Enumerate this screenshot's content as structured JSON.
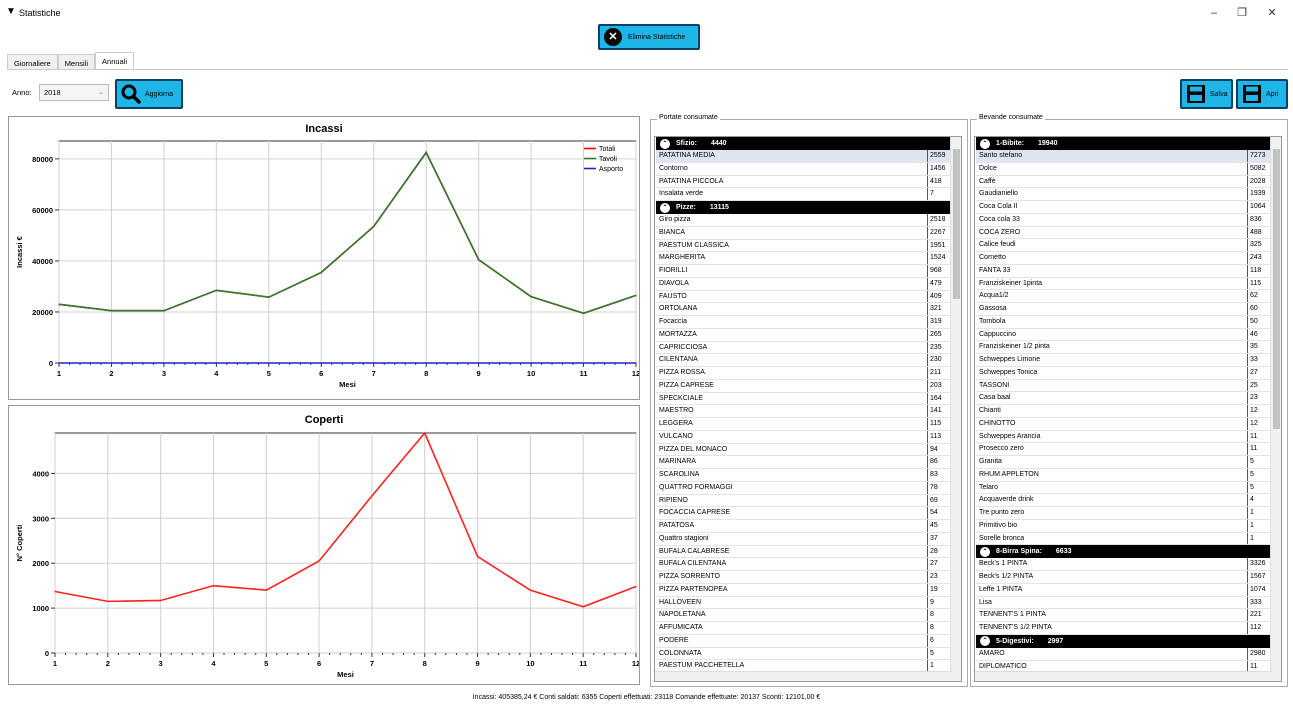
{
  "window": {
    "title": "Statistiche",
    "minimize": "–",
    "restore": "❐",
    "close": "✕"
  },
  "toolbar": {
    "elimina_label": "Elimina Statistiche"
  },
  "tabs": [
    {
      "label": "Giornaliere"
    },
    {
      "label": "Mensili"
    },
    {
      "label": "Annuali"
    }
  ],
  "controls": {
    "anno_label": "Anno:",
    "anno_value": "2018",
    "aggiorna_label": "Aggiorna",
    "salva_label": "Salva",
    "apri_label": "Apri"
  },
  "colors": {
    "button": "#1fb5e6",
    "totali": "#ff0000",
    "tavoli": "#2e7d32",
    "asporto": "#2222cc",
    "coperti": "#ff2020"
  },
  "chart_data": [
    {
      "type": "line",
      "title": "Incassi",
      "xlabel": "Mesi",
      "ylabel": "Incassi €",
      "x": [
        1,
        2,
        3,
        4,
        5,
        6,
        7,
        8,
        9,
        10,
        11,
        12
      ],
      "ylim": [
        0,
        87000
      ],
      "yticks": [
        0,
        20000,
        40000,
        60000,
        80000
      ],
      "legend_position": "top-right",
      "grid": true,
      "series": [
        {
          "name": "Totali",
          "color": "#ff0000",
          "values": [
            23000,
            20500,
            20500,
            28500,
            25800,
            35500,
            53500,
            82500,
            40500,
            26000,
            19500,
            26500
          ]
        },
        {
          "name": "Tavoli",
          "color": "#2e7d32",
          "values": [
            23000,
            20500,
            20500,
            28500,
            25800,
            35500,
            53500,
            82500,
            40500,
            26000,
            19500,
            26500
          ]
        },
        {
          "name": "Asporto",
          "color": "#2222cc",
          "values": [
            0,
            0,
            0,
            0,
            0,
            0,
            0,
            0,
            0,
            0,
            0,
            0
          ]
        }
      ]
    },
    {
      "type": "line",
      "title": "Coperti",
      "xlabel": "Mesi",
      "ylabel": "N° Coperti",
      "x": [
        1,
        2,
        3,
        4,
        5,
        6,
        7,
        8,
        9,
        10,
        11,
        12
      ],
      "ylim": [
        0,
        4900
      ],
      "yticks": [
        0,
        1000,
        2000,
        3000,
        4000
      ],
      "grid": true,
      "series": [
        {
          "values": [
            1370,
            1150,
            1170,
            1500,
            1400,
            2050,
            3500,
            4900,
            2150,
            1400,
            1030,
            1480
          ]
        }
      ]
    }
  ],
  "portate": {
    "title": "Portate consumate",
    "groups": [
      {
        "name": "Sfizio:",
        "count": "4440",
        "items": [
          {
            "name": "PATATINA MEDIA",
            "qty": "2559"
          },
          {
            "name": "Contorno",
            "qty": "1456"
          },
          {
            "name": "PATATINA PICCOLA",
            "qty": "418"
          },
          {
            "name": "Insalata verde",
            "qty": "7"
          }
        ]
      },
      {
        "name": "Pizze:",
        "count": "13115",
        "items": [
          {
            "name": "Giro pizza",
            "qty": "2518"
          },
          {
            "name": "BIANCA",
            "qty": "2267"
          },
          {
            "name": "PAESTUM CLASSICA",
            "qty": "1951"
          },
          {
            "name": "MARGHERITA",
            "qty": "1524"
          },
          {
            "name": "FIORILLI",
            "qty": "968"
          },
          {
            "name": "DIAVOLA",
            "qty": "479"
          },
          {
            "name": "FAUSTO",
            "qty": "409"
          },
          {
            "name": "ORTOLANA",
            "qty": "321"
          },
          {
            "name": "Focaccia",
            "qty": "319"
          },
          {
            "name": "MORTAZZA",
            "qty": "265"
          },
          {
            "name": "CAPRICCIOSA",
            "qty": "235"
          },
          {
            "name": "CILENTANA",
            "qty": "230"
          },
          {
            "name": "PIZZA ROSSA",
            "qty": "211"
          },
          {
            "name": "PIZZA CAPRESE",
            "qty": "203"
          },
          {
            "name": "SPECKCIALE",
            "qty": "164"
          },
          {
            "name": "MAESTRO",
            "qty": "141"
          },
          {
            "name": "LEGGERA",
            "qty": "115"
          },
          {
            "name": "VULCANO",
            "qty": "113"
          },
          {
            "name": "PIZZA DEL MONACO",
            "qty": "94"
          },
          {
            "name": "MARINARA",
            "qty": "86"
          },
          {
            "name": "SCAROLINA",
            "qty": "83"
          },
          {
            "name": "QUATTRO FORMAGGI",
            "qty": "78"
          },
          {
            "name": "RIPIENO",
            "qty": "69"
          },
          {
            "name": "FOCACCIA CAPRESE",
            "qty": "54"
          },
          {
            "name": "PATATOSA",
            "qty": "45"
          },
          {
            "name": "Quattro stagioni",
            "qty": "37"
          },
          {
            "name": "BUFALA CALABRESE",
            "qty": "28"
          },
          {
            "name": "BUFALA CILENTANA",
            "qty": "27"
          },
          {
            "name": "PIZZA SORRENTO",
            "qty": "23"
          },
          {
            "name": "PIZZA PARTENOPEA",
            "qty": "19"
          },
          {
            "name": "HALLOVEEN",
            "qty": "9"
          },
          {
            "name": "NAPOLETANA",
            "qty": "8"
          },
          {
            "name": "AFFUMICATA",
            "qty": "8"
          },
          {
            "name": "PODERE",
            "qty": "6"
          },
          {
            "name": "COLONNATA",
            "qty": "5"
          },
          {
            "name": "PAESTUM PACCHETELLA",
            "qty": "1"
          }
        ]
      }
    ]
  },
  "bevande": {
    "title": "Bevande consumate",
    "groups": [
      {
        "name": "1-Bibite:",
        "count": "19940",
        "items": [
          {
            "name": "Santo stefano",
            "qty": "7273"
          },
          {
            "name": "Dolce",
            "qty": "5082"
          },
          {
            "name": "Caffè",
            "qty": "2028"
          },
          {
            "name": "Gaudianiello",
            "qty": "1939"
          },
          {
            "name": "Coca Cola II",
            "qty": "1064"
          },
          {
            "name": "Coca cola 33",
            "qty": "836"
          },
          {
            "name": "COCA ZERO",
            "qty": "488"
          },
          {
            "name": "Calice feudi",
            "qty": "325"
          },
          {
            "name": "Cornetto",
            "qty": "243"
          },
          {
            "name": "FANTA 33",
            "qty": "118"
          },
          {
            "name": "Franziskeiner 1pinta",
            "qty": "115"
          },
          {
            "name": "Acqua1/2",
            "qty": "62"
          },
          {
            "name": "Gassosa",
            "qty": "60"
          },
          {
            "name": "Tombola",
            "qty": "50"
          },
          {
            "name": "Cappuccino",
            "qty": "46"
          },
          {
            "name": "Franziskeiner 1/2 pinta",
            "qty": "35"
          },
          {
            "name": "Schweppes Limone",
            "qty": "33"
          },
          {
            "name": "Schweppes Tonica",
            "qty": "27"
          },
          {
            "name": "TASSONI",
            "qty": "25"
          },
          {
            "name": "Casa baal",
            "qty": "23"
          },
          {
            "name": "Chianti",
            "qty": "12"
          },
          {
            "name": "CHINOTTO",
            "qty": "12"
          },
          {
            "name": "Schweppes Arancia",
            "qty": "11"
          },
          {
            "name": "Prosecco zero",
            "qty": "11"
          },
          {
            "name": "Granita",
            "qty": "5"
          },
          {
            "name": "RHUM APPLETON",
            "qty": "5"
          },
          {
            "name": "Telaro",
            "qty": "5"
          },
          {
            "name": "Acquaverde drink",
            "qty": "4"
          },
          {
            "name": "Tre punto zero",
            "qty": "1"
          },
          {
            "name": "Primitivo bio",
            "qty": "1"
          },
          {
            "name": "Sorelle bronca",
            "qty": "1"
          }
        ]
      },
      {
        "name": "8-Birra Spina:",
        "count": "6633",
        "items": [
          {
            "name": "Beck's 1 PINTA",
            "qty": "3326"
          },
          {
            "name": "Beck's 1/2 PINTA",
            "qty": "1567"
          },
          {
            "name": "Leffe 1 PINTA",
            "qty": "1074"
          },
          {
            "name": "Lisa",
            "qty": "333"
          },
          {
            "name": "TENNENT'S 1 PINTA",
            "qty": "221"
          },
          {
            "name": "TENNENT'S 1/2 PINTA",
            "qty": "112"
          }
        ]
      },
      {
        "name": "5-Digestivi:",
        "count": "2997",
        "items": [
          {
            "name": "AMARO",
            "qty": "2980"
          },
          {
            "name": "DIPLOMATICO",
            "qty": "11"
          }
        ]
      }
    ]
  },
  "status": "Incassi: 405385,24 €   Conti saldati: 6355   Coperti effettuati: 23118   Comande effettuate: 20137   Sconti: 12101,00 €"
}
